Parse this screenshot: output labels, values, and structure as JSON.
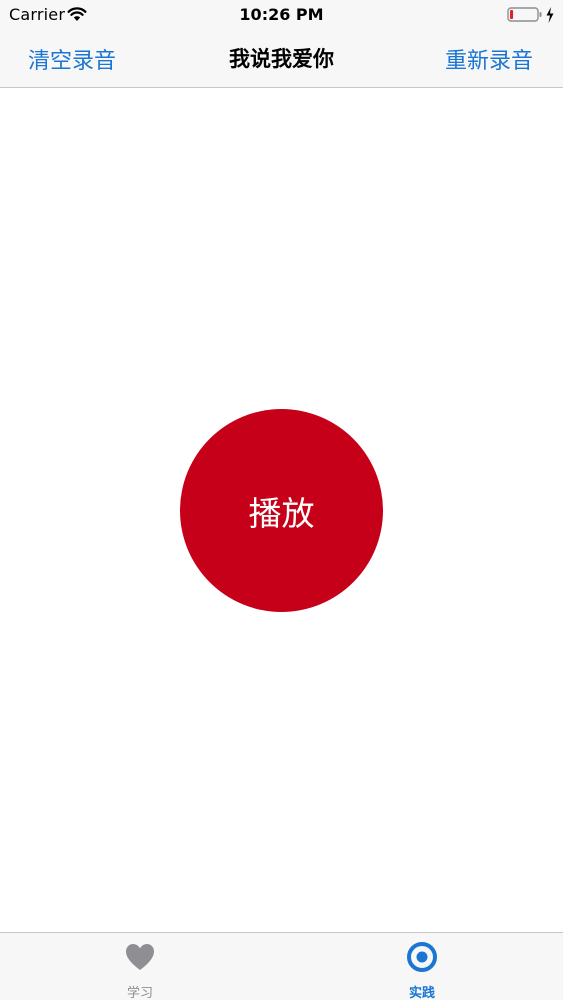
{
  "status_bar": {
    "carrier": "Carrier",
    "time": "10:26 PM",
    "battery_level_fraction": 0.12,
    "charging": true
  },
  "nav_bar": {
    "left_button": "清空录音",
    "title": "我说我爱你",
    "right_button": "重新录音"
  },
  "main": {
    "play_button_label": "播放"
  },
  "tab_bar": {
    "tabs": [
      {
        "label": "学习",
        "icon": "heart-icon",
        "selected": false
      },
      {
        "label": "实践",
        "icon": "target-icon",
        "selected": true
      }
    ]
  },
  "colors": {
    "accent": "#1a76d2",
    "play_button": "#c60018",
    "inactive_tab": "#8e8e93",
    "bar_background": "#f7f7f7",
    "battery_low": "#e0212c"
  }
}
